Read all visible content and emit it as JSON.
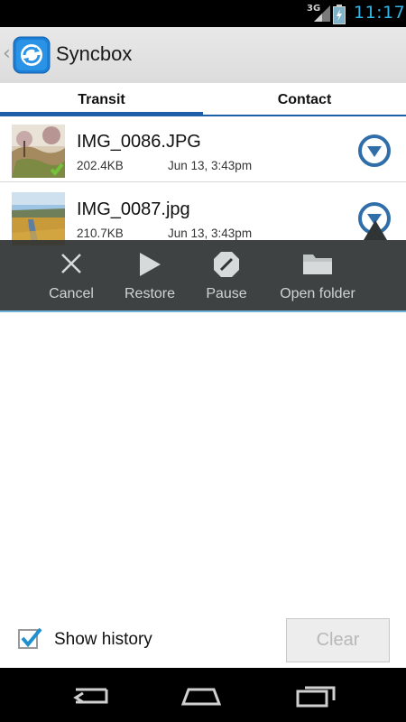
{
  "status_bar": {
    "network": "3G",
    "time": "11:17"
  },
  "action_bar": {
    "title": "Syncbox",
    "logo": "syncbox-logo-icon",
    "back_icon": "back-chevron-icon"
  },
  "tabs": [
    {
      "label": "Transit",
      "active": true
    },
    {
      "label": "Contact",
      "active": false
    }
  ],
  "files": [
    {
      "name": "IMG_0086.JPG",
      "size": "202.4KB",
      "date": "Jun 13, 3:43pm",
      "status": "synced"
    },
    {
      "name": "IMG_0087.jpg",
      "size": "210.7KB",
      "date": "Jun 13, 3:43pm",
      "status": "synced"
    }
  ],
  "popup_actions": [
    {
      "label": "Cancel",
      "icon": "close-icon"
    },
    {
      "label": "Restore",
      "icon": "play-icon"
    },
    {
      "label": "Pause",
      "icon": "pause-stop-icon"
    },
    {
      "label": "Open folder",
      "icon": "folder-icon"
    }
  ],
  "footer": {
    "show_history_label": "Show history",
    "show_history_checked": true,
    "clear_label": "Clear"
  },
  "colors": {
    "accent_blue": "#1f5faa",
    "holo_blue": "#33b5e5",
    "popup_bg": "#303434"
  }
}
